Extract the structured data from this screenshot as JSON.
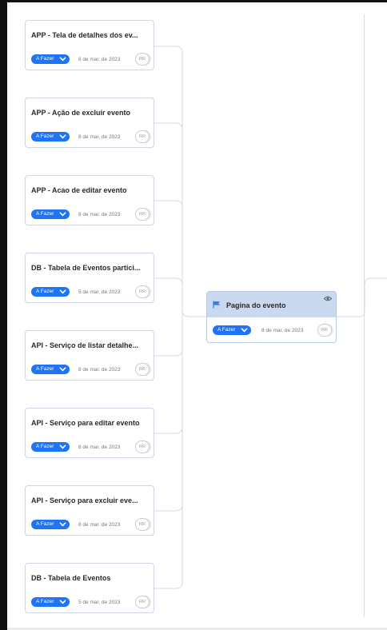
{
  "cards": [
    {
      "title": "APP - Tela de detalhes dos ev...",
      "status": "A Fazer",
      "date": "8 de mar. de 2023",
      "assignee": "RR"
    },
    {
      "title": "APP - Ação de excluir evento",
      "status": "A Fazer",
      "date": "8 de mar. de 2023",
      "assignee": "RR"
    },
    {
      "title": "APP - Acao de editar evento",
      "status": "A Fazer",
      "date": "8 de mar. de 2023",
      "assignee": "RR"
    },
    {
      "title": "DB - Tabela de Eventos partici...",
      "status": "A Fazer",
      "date": "5 de mar. de 2023",
      "assignee": "RR"
    },
    {
      "title": "API - Serviço de listar detalhe...",
      "status": "A Fazer",
      "date": "8 de mar. de 2023",
      "assignee": "RR"
    },
    {
      "title": "API - Serviço para editar evento",
      "status": "A Fazer",
      "date": "8 de mar. de 2023",
      "assignee": "RR"
    },
    {
      "title": "API - Serviço para excluir eve...",
      "status": "A Fazer",
      "date": "8 de mar. de 2023",
      "assignee": "RR"
    },
    {
      "title": "DB - Tabela de Eventos",
      "status": "A Fazer",
      "date": "5 de mar. de 2023",
      "assignee": "RR"
    }
  ],
  "parent": {
    "title": "Pagina do evento",
    "status": "A Fazer",
    "date": "8 de mar. de 2023",
    "assignee": "RR"
  },
  "colors": {
    "status_button": "#1f74f5",
    "parent_header": "#c8d9f0",
    "card_border": "#cfd6e3",
    "connector": "#d5dae2"
  },
  "icons": {
    "parent_flag": "flag-icon",
    "parent_watch": "eye-icon",
    "status_dropdown": "chevron-down-icon"
  }
}
